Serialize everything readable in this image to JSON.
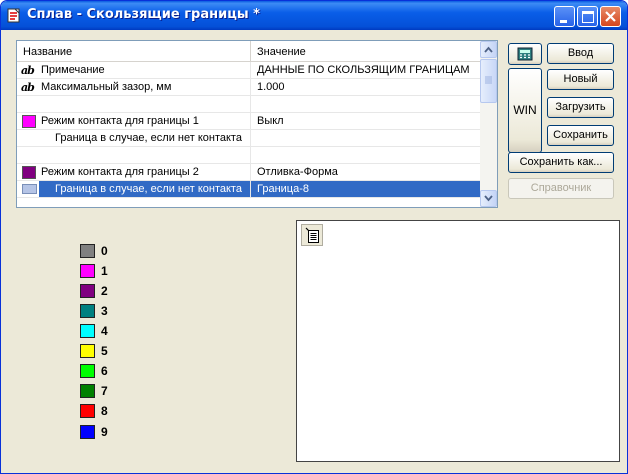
{
  "window": {
    "title": "Сплав - Скользящие границы *",
    "title_color": "#0a5ee8",
    "controls": [
      "minimize-icon",
      "maximize-icon",
      "close-icon"
    ]
  },
  "grid": {
    "columns": [
      "Название",
      "Значение"
    ],
    "rows": [
      {
        "icon": "text-ab-icon",
        "name": "Примечание",
        "value": "ДАННЫЕ ПО СКОЛЬЗЯЩИМ ГРАНИЦАМ"
      },
      {
        "icon": "text-ab-icon",
        "name": "Максимальный зазор, мм",
        "value": "1.000"
      },
      {
        "icon": "",
        "name": "",
        "value": ""
      },
      {
        "icon": "color-swatch",
        "color": "#ff00ff",
        "name": "Режим контакта для границы 1",
        "value": "Выкл"
      },
      {
        "icon": "",
        "name": "Граница в случае, если нет контакта",
        "value": ""
      },
      {
        "icon": "",
        "name": "",
        "value": ""
      },
      {
        "icon": "color-swatch",
        "color": "#800080",
        "name": "Режим контакта для границы 2",
        "value": "Отливка-Форма"
      },
      {
        "icon": "row-selector-icon",
        "name": "Граница в случае, если нет контакта",
        "value": "Граница-8",
        "selected": true
      }
    ],
    "selection_color": "#316ac5"
  },
  "buttons": {
    "calculator": "calculator-icon",
    "win": "WIN",
    "input": "Ввод",
    "new": "Новый",
    "load": "Загрузить",
    "save": "Сохранить",
    "save_as": "Сохранить как...",
    "reference": "Справочник"
  },
  "legend": [
    {
      "label": "0",
      "color": "#808080"
    },
    {
      "label": "1",
      "color": "#ff00ff"
    },
    {
      "label": "2",
      "color": "#800080"
    },
    {
      "label": "3",
      "color": "#008080"
    },
    {
      "label": "4",
      "color": "#00ffff"
    },
    {
      "label": "5",
      "color": "#ffff00"
    },
    {
      "label": "6",
      "color": "#00ff00"
    },
    {
      "label": "7",
      "color": "#008000"
    },
    {
      "label": "8",
      "color": "#ff0000"
    },
    {
      "label": "9",
      "color": "#0000ff"
    }
  ],
  "canvas": {
    "tool_icon": "document-list-icon"
  }
}
